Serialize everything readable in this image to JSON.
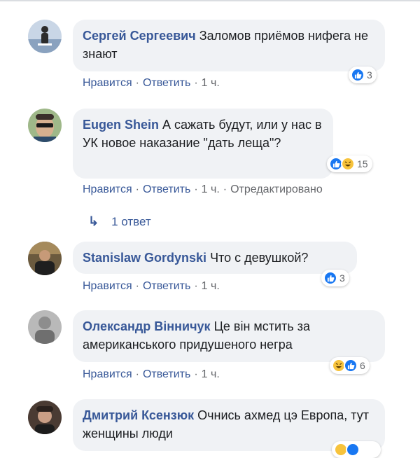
{
  "labels": {
    "like": "Нравится",
    "reply": "Ответить",
    "dot": "·"
  },
  "comments": [
    {
      "author": "Сергей Сергеевич",
      "text": "Заломов приёмов нифега не знают",
      "reactions": "3",
      "time": "1 ч.",
      "edited": ""
    },
    {
      "author": "Eugen Shein",
      "text": "А сажать будут, или у нас в УК новое наказание \"дать леща\"?",
      "reactions": "15",
      "time": "1 ч.",
      "edited": "Отредактировано"
    },
    {
      "author": "Stanislaw Gordynski",
      "text": "Что с девушкой?",
      "reactions": "3",
      "time": "1 ч.",
      "edited": ""
    },
    {
      "author": "Олександр Вінничук",
      "text": "Це він мстить за американського придушеного негра",
      "reactions": "6",
      "time": "1 ч.",
      "edited": ""
    },
    {
      "author": "Дмитрий Ксензюк",
      "text": "Очнись ахмед цэ Европа, тут женщины люди",
      "reactions": "",
      "time": "",
      "edited": ""
    }
  ],
  "replies_link": {
    "arrow": "↳",
    "label": "1 ответ"
  },
  "colors": {
    "author": "#385898",
    "bubble": "#f0f2f5",
    "like": "#1877f2",
    "haha": "#f7c33c"
  }
}
